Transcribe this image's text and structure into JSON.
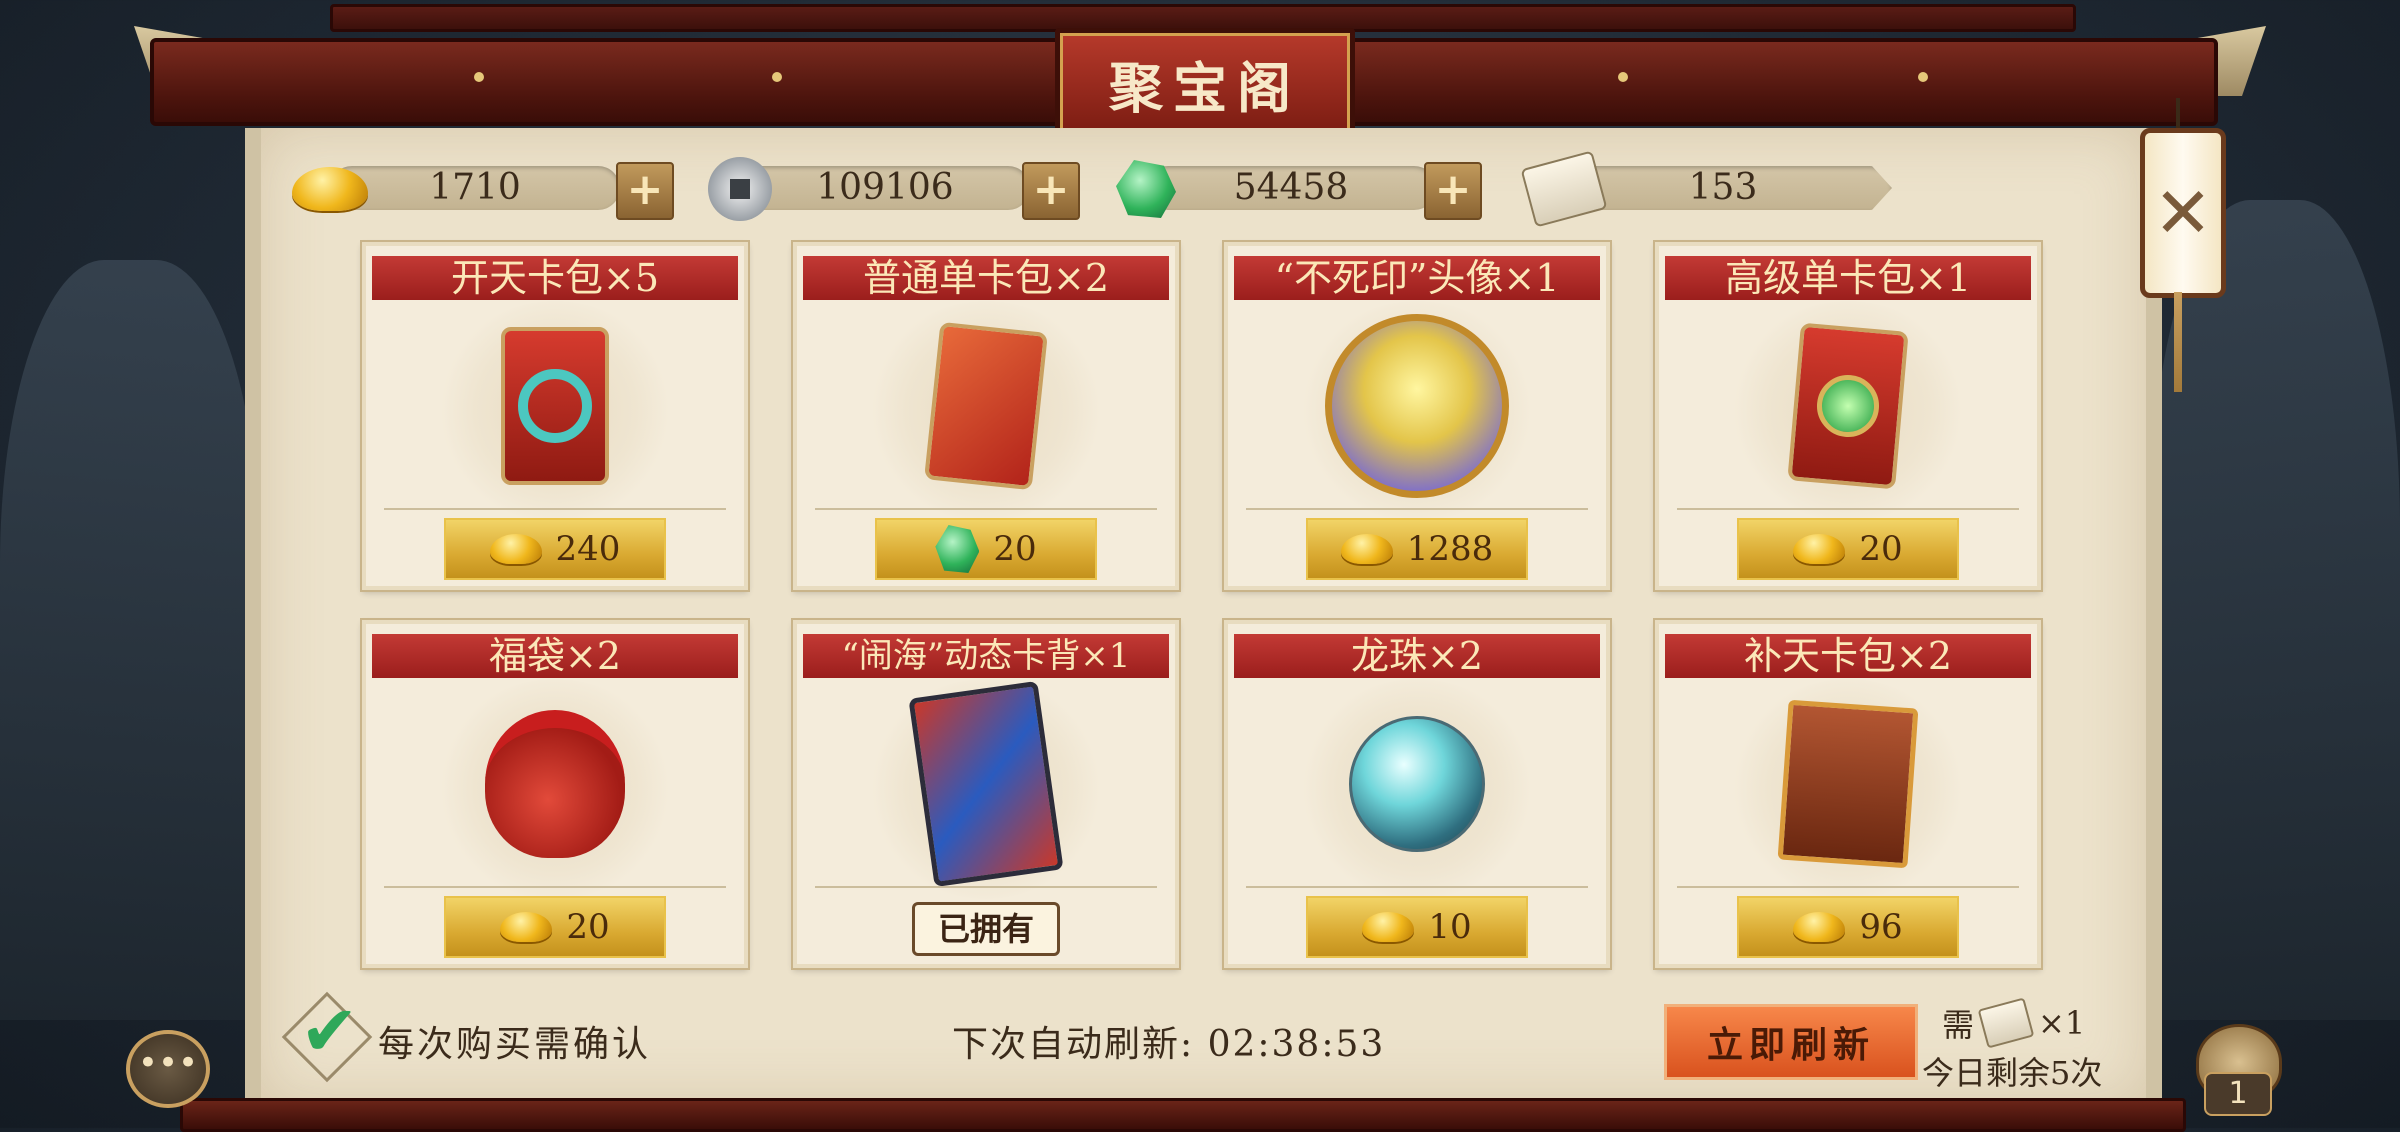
{
  "title": "聚宝阁",
  "currencies": [
    {
      "icon": "gold-ingot-icon",
      "value": "1710"
    },
    {
      "icon": "silver-coin-icon",
      "value": "109106"
    },
    {
      "icon": "jade-icon",
      "value": "54458"
    },
    {
      "icon": "refresh-scroll-icon",
      "value": "153"
    }
  ],
  "items": [
    {
      "name": "开天卡包×5",
      "price": "240",
      "currency": "gold-ingot-icon",
      "art": "card-pack-icon"
    },
    {
      "name": "普通单卡包×2",
      "price": "20",
      "currency": "jade-icon",
      "art": "card-pack-icon"
    },
    {
      "name": "“不死印”头像×1",
      "price": "1288",
      "currency": "gold-ingot-icon",
      "art": "avatar-icon"
    },
    {
      "name": "高级单卡包×1",
      "price": "20",
      "currency": "gold-ingot-icon",
      "art": "card-pack-icon"
    },
    {
      "name": "福袋×2",
      "price": "20",
      "currency": "gold-ingot-icon",
      "art": "lucky-bag-icon"
    },
    {
      "name": "“闹海”动态卡背×1",
      "price": "",
      "owned": "已拥有",
      "art": "card-back-icon"
    },
    {
      "name": "龙珠×2",
      "price": "10",
      "currency": "gold-ingot-icon",
      "art": "dragon-orb-icon"
    },
    {
      "name": "补天卡包×2",
      "price": "96",
      "currency": "gold-ingot-icon",
      "art": "book-pack-icon"
    }
  ],
  "footer": {
    "confirm_label": "每次购买需确认",
    "timer_label": "下次自动刷新: 02:38:53",
    "refresh_button": "立即刷新",
    "need_prefix": "需",
    "need_suffix": "×1",
    "remaining": "今日剩余5次"
  },
  "corner": {
    "chat_icon": "chat-bubble-icon",
    "bag_count": "1"
  },
  "colors": {
    "header_red": "#c33a35",
    "price_gold": "#d9a931",
    "refresh_orange": "#e8632b",
    "panel_bg": "#ece2cb"
  }
}
